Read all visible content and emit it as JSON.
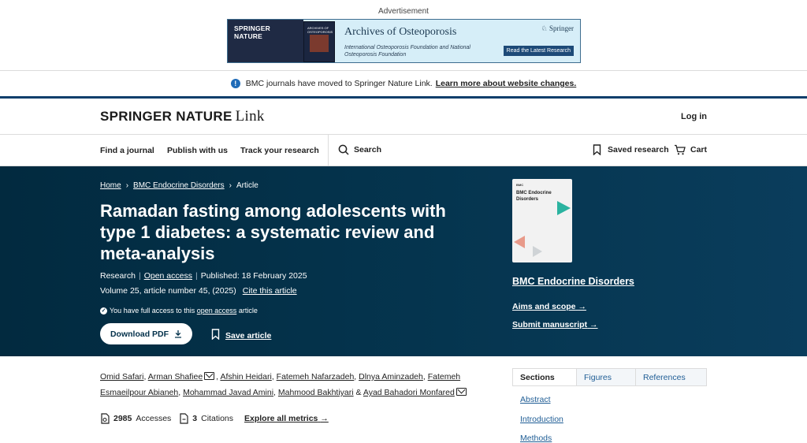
{
  "ad": {
    "label": "Advertisement",
    "brand": "SPRINGER NATURE",
    "cover_title": "ARCHIVES OF OSTEOPOROSIS",
    "title": "Archives of Osteoporosis",
    "subtitle": "International Osteoporosis Foundation and National Osteoporosis Foundation",
    "publisher": "Springer",
    "button": "Read the Latest Research"
  },
  "notice": {
    "text": "BMC journals have moved to Springer Nature Link.",
    "link": "Learn more about website changes."
  },
  "header": {
    "logo_main": "SPRINGER NATURE",
    "logo_sub": "Link",
    "login": "Log in"
  },
  "nav": {
    "find_journal": "Find a journal",
    "publish": "Publish with us",
    "track": "Track your research",
    "search": "Search",
    "saved": "Saved research",
    "cart": "Cart"
  },
  "breadcrumb": {
    "home": "Home",
    "journal": "BMC Endocrine Disorders",
    "current": "Article"
  },
  "article": {
    "title": "Ramadan fasting among adolescents with type 1 diabetes: a systematic review and meta-analysis",
    "type": "Research",
    "open_access": "Open access",
    "published": "Published: 18 February 2025",
    "volume": "Volume 25, article number 45, (2025)",
    "cite": "Cite this article",
    "access_prefix": "You have full access to this",
    "access_link": "open access",
    "access_suffix": "article",
    "download": "Download PDF",
    "save": "Save article"
  },
  "journal_box": {
    "cover_brand": "BMC",
    "cover_title": "BMC Endocrine Disorders",
    "name": "BMC Endocrine Disorders",
    "aims": "Aims and scope",
    "submit": "Submit manuscript"
  },
  "authors": {
    "a1": "Omid Safari",
    "a2": "Arman Shafiee",
    "a3": "Afshin Heidari",
    "a4": "Fatemeh Nafarzadeh",
    "a5": "Dlnya Aminzadeh",
    "a6a": "Fatemeh",
    "a6b": "Esmaeilpour Abianeh",
    "a7": "Mohammad Javad Amini",
    "a8": "Mahmood Bakhtiyari",
    "a9": "Ayad Bahadori Monfared",
    "comma": ",",
    "amp": "&"
  },
  "metrics": {
    "accesses_value": "2985",
    "accesses_label": "Accesses",
    "citations_value": "3",
    "citations_label": "Citations",
    "explore": "Explore all metrics"
  },
  "tabs": [
    "Sections",
    "Figures",
    "References"
  ],
  "toc": [
    "Abstract",
    "Introduction",
    "Methods"
  ],
  "icons": {
    "info": "info-icon",
    "search": "search-icon",
    "bookmark": "bookmark-icon",
    "cart": "cart-icon",
    "download": "download-icon",
    "mail": "mail-icon",
    "check": "check-circle-icon",
    "arrow": "arrow-right-icon"
  },
  "colors": {
    "hero_bg": "#04324b",
    "notice_border": "#0e3e6b",
    "link": "#1f5d95",
    "info": "#1e6bb8"
  }
}
